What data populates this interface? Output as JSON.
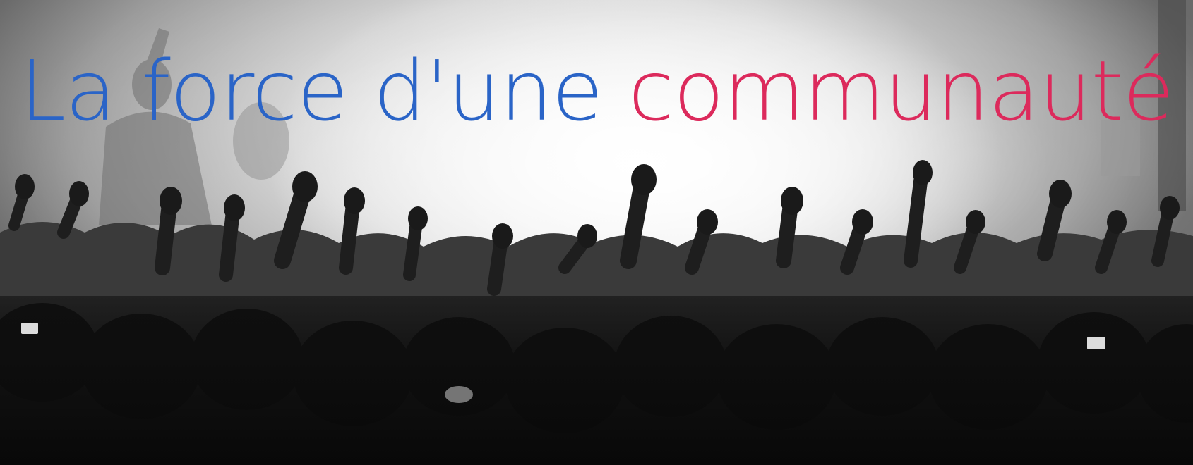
{
  "hero": {
    "headline_part1": "La force d'une",
    "headline_part2": "communauté",
    "colors": {
      "part1": "#2a64c7",
      "part2": "#dc2a5c"
    },
    "image_description_icon": "concert-crowd-photo"
  }
}
